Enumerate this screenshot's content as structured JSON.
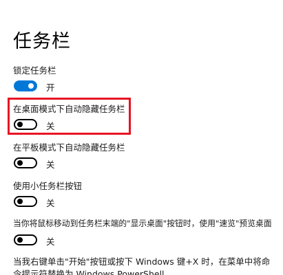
{
  "title": "任务栏",
  "settings": [
    {
      "label": "锁定任务栏",
      "state": "开",
      "on": true
    },
    {
      "label": "在桌面模式下自动隐藏任务栏",
      "state": "关",
      "on": false
    },
    {
      "label": "在平板模式下自动隐藏任务栏",
      "state": "关",
      "on": false
    },
    {
      "label": "使用小任务栏按钮",
      "state": "关",
      "on": false
    },
    {
      "label": "当你将鼠标移动到任务栏末端的\"显示桌面\"按钮时，使用\"速览\"预览桌面",
      "state": "关",
      "on": false
    },
    {
      "label": "当我右键单击\"开始\"按钮或按下 Windows 键+X 时，在菜单中将命令提示符替换为 Windows PowerShell"
    }
  ],
  "colors": {
    "accent": "#0078d7",
    "highlight": "#e81123"
  }
}
